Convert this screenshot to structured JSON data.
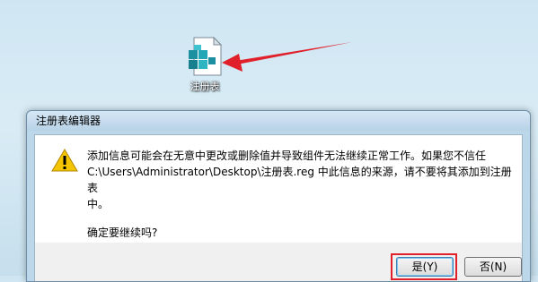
{
  "desktop": {
    "icon_label": "注册表"
  },
  "dialog": {
    "title": "注册表编辑器",
    "message_line1": "添加信息可能会在无意中更改或删除值并导致组件无法继续正常工作。如果您不信任",
    "message_line2": "C:\\Users\\Administrator\\Desktop\\注册表.reg 中此信息的来源，请不要将其添加到注册表",
    "message_line3": "中。",
    "question": "确定要继续吗?",
    "yes_label": "是(Y)",
    "no_label": "否(N)"
  },
  "colors": {
    "highlight": "#e0202a",
    "arrow": "#e0202a"
  }
}
